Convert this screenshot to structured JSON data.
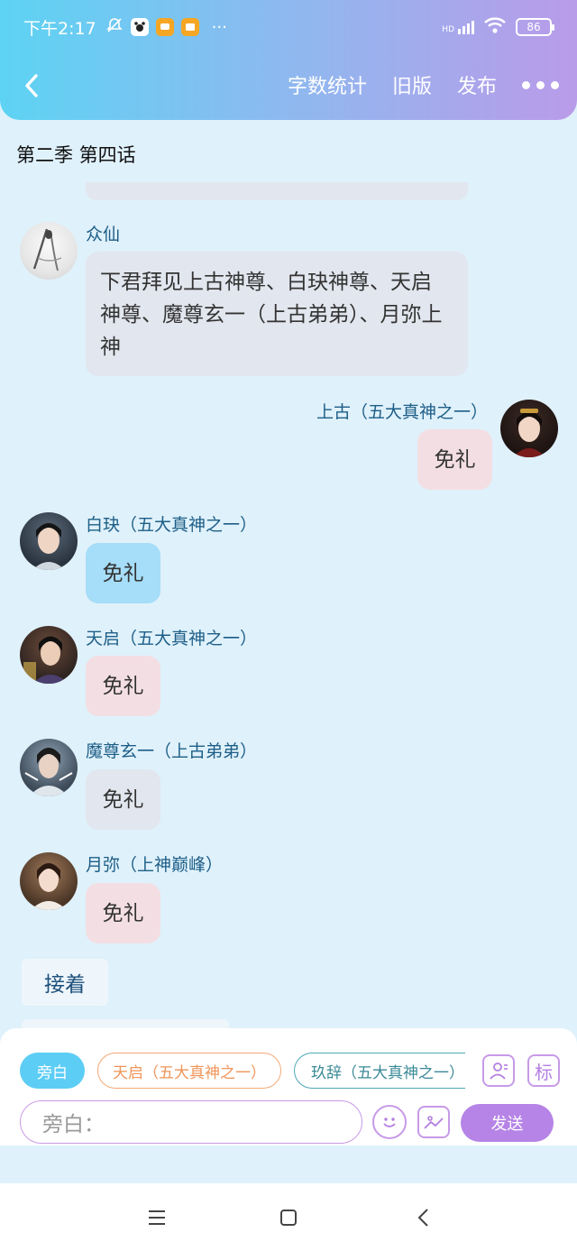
{
  "status_bar": {
    "time": "下午2:17",
    "battery": "86",
    "network": "HD",
    "more": "···"
  },
  "header": {
    "actions": [
      "字数统计",
      "旧版",
      "发布"
    ]
  },
  "chapter_title": "第二季 第四话",
  "messages": [
    {
      "speaker": "众仙",
      "text": "下君拜见上古神尊、白玦神尊、天启神尊、魔尊玄一（上古弟弟）、月弥上神",
      "side": "left"
    },
    {
      "speaker": "上古（五大真神之一）",
      "text": "免礼",
      "side": "right"
    },
    {
      "speaker": "白玦（五大真神之一）",
      "text": "免礼",
      "side": "left"
    },
    {
      "speaker": "天启（五大真神之一）",
      "text": "免礼",
      "side": "left"
    },
    {
      "speaker": "魔尊玄一（上古弟弟）",
      "text": "免礼",
      "side": "left"
    },
    {
      "speaker": "月弥（上神巅峰）",
      "text": "免礼",
      "side": "left"
    }
  ],
  "next_label": "接着",
  "composer": {
    "chips": [
      "旁白",
      "天启（五大真神之一）",
      "玖辞（五大真神之一）"
    ],
    "tag_label": "标",
    "placeholder": "旁白：",
    "send_label": "发送"
  },
  "colors": {
    "accent": "#b684e6",
    "header_start": "#5dd3f3",
    "header_end": "#b99be9",
    "name": "#1d5e87",
    "background": "#dff1fb"
  }
}
